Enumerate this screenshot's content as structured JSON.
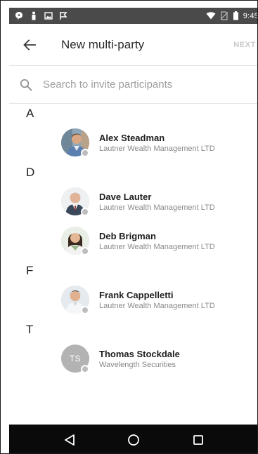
{
  "status_bar": {
    "time": "9:45",
    "icons": [
      "chat-bubble-icon",
      "person-icon",
      "image-icon",
      "check-flag-icon",
      "wifi-icon",
      "no-sim-icon",
      "battery-icon"
    ]
  },
  "app_bar": {
    "title": "New multi-party",
    "next_label": "NEXT",
    "back_icon": "arrow-back-icon"
  },
  "search": {
    "placeholder": "Search to invite participants",
    "value": ""
  },
  "sections": [
    {
      "letter": "A",
      "contacts": [
        {
          "name": "Alex Steadman",
          "company": "Lautner Wealth Management LTD",
          "avatar": "photo"
        }
      ]
    },
    {
      "letter": "D",
      "contacts": [
        {
          "name": "Dave Lauter",
          "company": "Lautner Wealth Management LTD",
          "avatar": "photo"
        },
        {
          "name": "Deb Brigman",
          "company": "Lautner Wealth Management LTD",
          "avatar": "photo"
        }
      ]
    },
    {
      "letter": "F",
      "contacts": [
        {
          "name": "Frank Cappelletti",
          "company": "Lautner Wealth Management LTD",
          "avatar": "photo"
        }
      ]
    },
    {
      "letter": "T",
      "contacts": [
        {
          "name": "Thomas Stockdale",
          "company": "Wavelength Securities",
          "avatar": "initials",
          "initials": "TS"
        }
      ]
    }
  ],
  "colors": {
    "status_bar": "#4a4a4a",
    "nav_bar": "#0a0a0a",
    "presence_offline": "#bdbdbd",
    "next_disabled": "#c9c9c9"
  },
  "nav_bar": {
    "icons": [
      "back-triangle-icon",
      "home-circle-icon",
      "recents-square-icon"
    ]
  }
}
